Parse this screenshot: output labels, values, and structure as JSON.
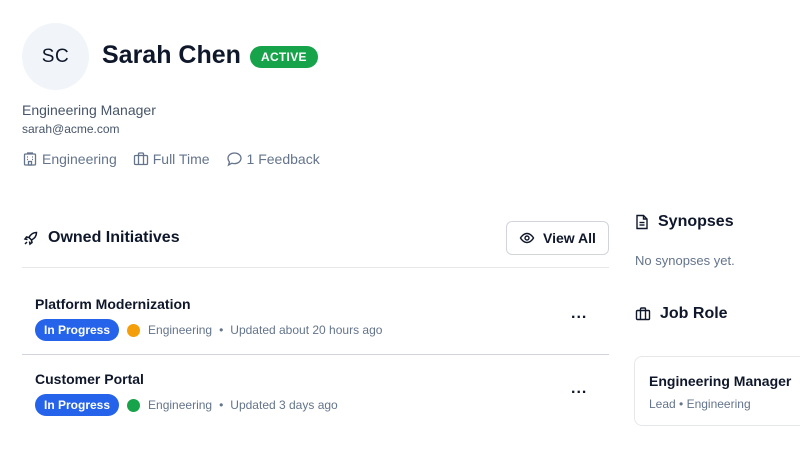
{
  "profile": {
    "initials": "SC",
    "name": "Sarah Chen",
    "status": "ACTIVE",
    "title": "Engineering Manager",
    "email": "sarah@acme.com",
    "meta": {
      "department": "Engineering",
      "employment": "Full Time",
      "feedback": "1 Feedback"
    }
  },
  "initiatives": {
    "heading": "Owned Initiatives",
    "view_all": "View All",
    "items": [
      {
        "title": "Platform Modernization",
        "status": "In Progress",
        "dot_color": "#f59e0b",
        "department": "Engineering",
        "separator": "•",
        "updated": "Updated about 20 hours ago",
        "more": "..."
      },
      {
        "title": "Customer Portal",
        "status": "In Progress",
        "dot_color": "#16a34a",
        "department": "Engineering",
        "separator": "•",
        "updated": "Updated 3 days ago",
        "more": "..."
      }
    ]
  },
  "synopses": {
    "heading": "Synopses",
    "empty": "No synopses yet."
  },
  "job_role": {
    "heading": "Job Role",
    "title": "Engineering Manager",
    "subtitle": "Lead • Engineering"
  },
  "colors": {
    "active": "#16a34a",
    "in_progress": "#2563eb"
  }
}
